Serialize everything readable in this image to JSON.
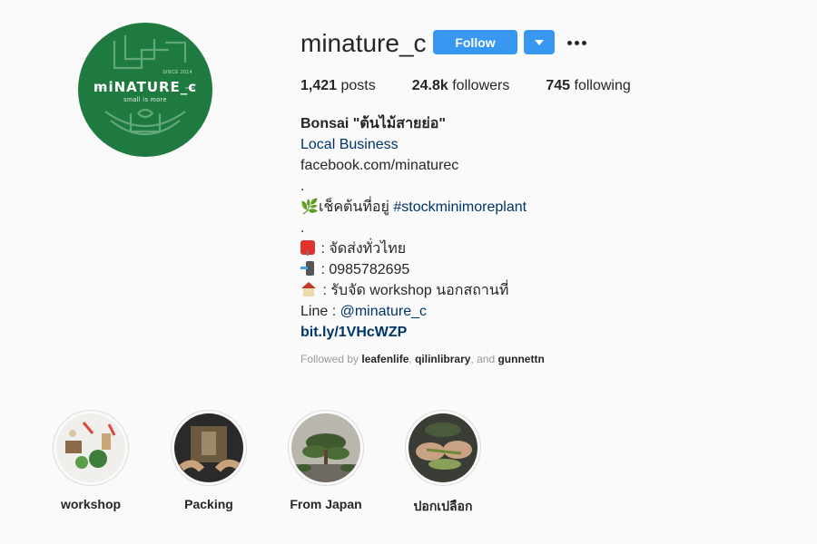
{
  "profile": {
    "avatar_logo": "miNATURE_c",
    "avatar_tagline": "small is more",
    "avatar_since": "SINCE 2014",
    "username": "minature_c",
    "follow_label": "Follow",
    "stats": {
      "posts_count": "1,421",
      "posts_label": " posts",
      "followers_count": "24.8k",
      "followers_label": " followers",
      "following_count": "745",
      "following_label": " following"
    }
  },
  "bio": {
    "name": "Bonsai \"ต้นไม้สายย่อ\"",
    "category": "Local Business",
    "line_facebook": "facebook.com/minaturec",
    "dot1": ".",
    "check_text": "เช็คต้นที่อยู่ ",
    "check_tag": "#stockminimoreplant",
    "dot2": ".",
    "shipping": " : จัดส่งทั่วไทย",
    "phone": " : 0985782695",
    "workshop": " : รับจัด workshop นอกสถานที่",
    "line_prefix": "Line : ",
    "line_id": "@minature_c",
    "link": "bit.ly/1VHcWZP"
  },
  "followed_by": {
    "prefix": "Followed by ",
    "user1": "leafenlife",
    "sep1": ", ",
    "user2": "qilinlibrary",
    "sep2": ", and ",
    "user3": "gunnettn"
  },
  "highlights": [
    {
      "label": "workshop"
    },
    {
      "label": "Packing"
    },
    {
      "label": "From Japan"
    },
    {
      "label": "ปอกเปลือก"
    }
  ],
  "colors": {
    "accent": "#3897f0",
    "link": "#003569",
    "avatar_bg": "#1f7a40"
  }
}
